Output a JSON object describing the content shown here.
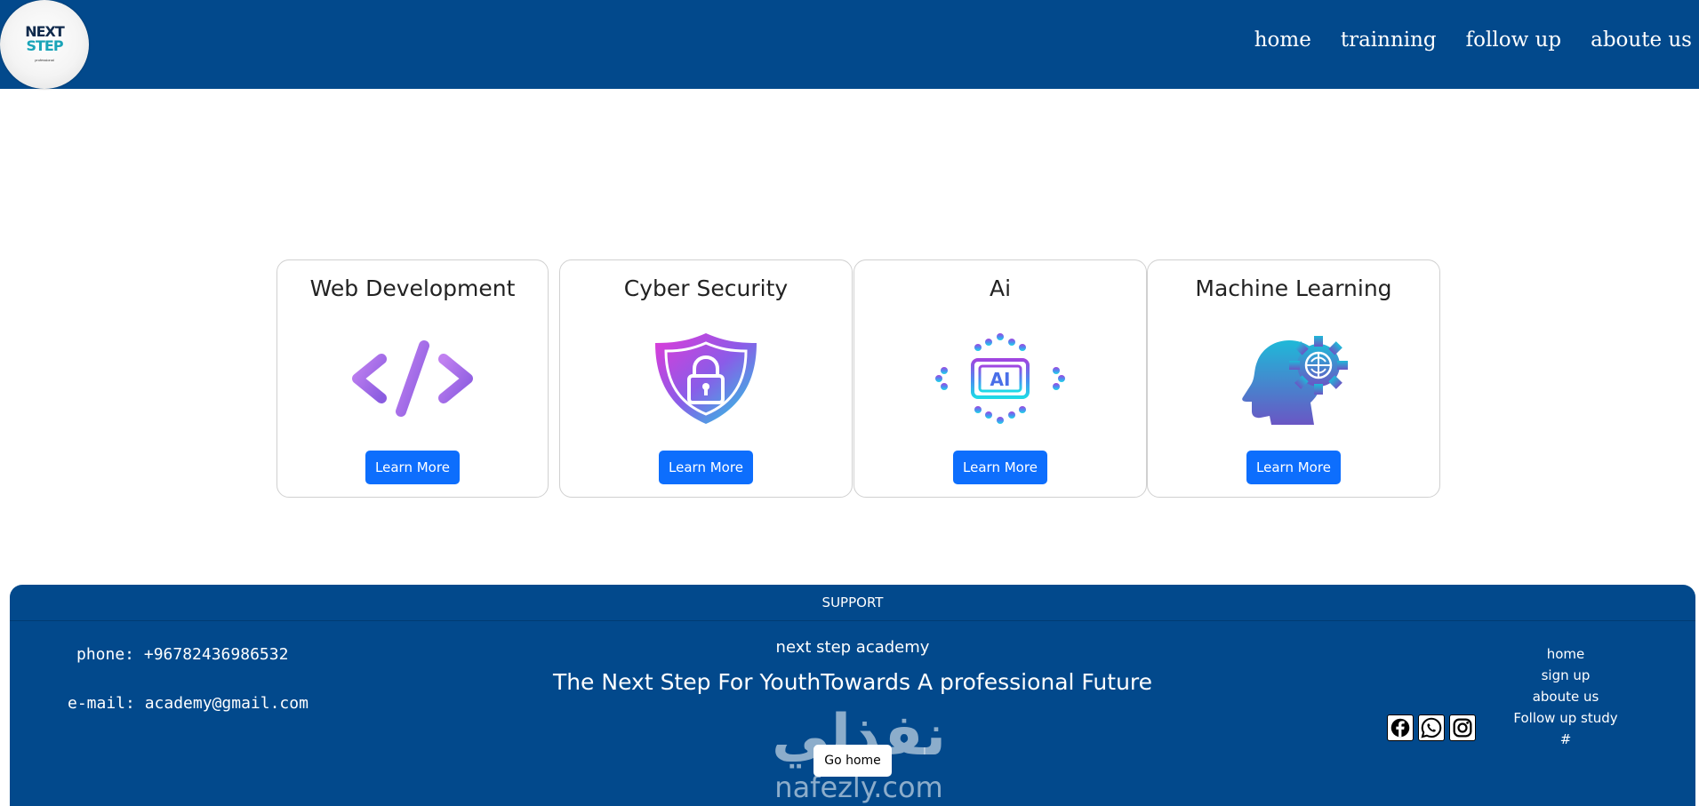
{
  "header": {
    "logo": {
      "line1": "NEXT",
      "line2": "STEP",
      "line3": "professional"
    },
    "nav": [
      "home",
      "trainning",
      "follow up",
      "aboute us"
    ]
  },
  "cards": [
    {
      "title": "Web Development",
      "icon": "code-icon",
      "button": "Learn More"
    },
    {
      "title": "Cyber Security",
      "icon": "shield-lock-icon",
      "button": "Learn More"
    },
    {
      "title": "Ai",
      "icon": "ai-chip-icon",
      "button": "Learn More"
    },
    {
      "title": "Machine Learning",
      "icon": "head-gear-icon",
      "button": "Learn More"
    }
  ],
  "footer": {
    "support_title": "SUPPORT",
    "phone": "phone: +96782436986532",
    "email": "e-mail: academy@gmail.com",
    "academy_name": "next step academy",
    "tagline": "The Next Step For YouthTowards A professional Future",
    "go_home_button": "Go home",
    "social": [
      "facebook-icon",
      "whatsapp-icon",
      "instagram-icon"
    ],
    "links": [
      "home",
      "sign up",
      "aboute us",
      "Follow up study",
      "#"
    ]
  },
  "watermark": {
    "arabic": "نفذلي",
    "latin": "nafezly.com"
  },
  "colors": {
    "primary": "#02498c",
    "button": "#0d6efd"
  }
}
